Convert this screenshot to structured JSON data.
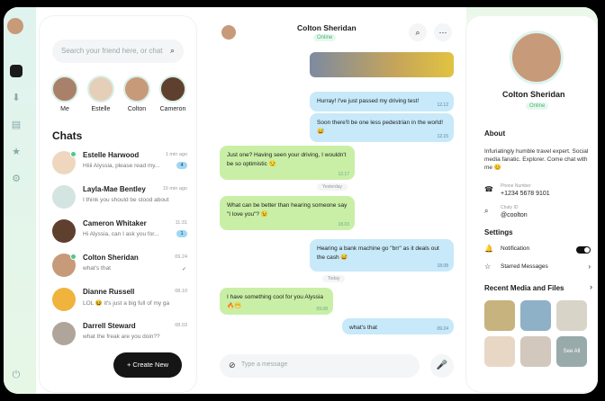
{
  "search": {
    "placeholder": "Search your friend here, or chat"
  },
  "stories": [
    {
      "name": "Me"
    },
    {
      "name": "Estelle"
    },
    {
      "name": "Colton"
    },
    {
      "name": "Cameron"
    }
  ],
  "chats_title": "Chats",
  "chats": [
    {
      "name": "Estelle Harwood",
      "preview": "Hiiii Alyssia, please read my...",
      "time": "1 min ago",
      "badge": "4",
      "online": true
    },
    {
      "name": "Layla-Mae Bentley",
      "preview": "I think you should be stood about ...",
      "time": "15 min ago"
    },
    {
      "name": "Cameron Whitaker",
      "preview": "Hi Alyssia, can I ask you for...",
      "time": "11:31",
      "badge": "1"
    },
    {
      "name": "Colton Sheridan",
      "preview": "what's that",
      "time": "09.24",
      "online": true
    },
    {
      "name": "Dianne Russell",
      "preview": "LOL 😆 it's just a big full of my ga...",
      "time": "08.10"
    },
    {
      "name": "Darrell Steward",
      "preview": "what the freak are you doin??",
      "time": "08.03"
    }
  ],
  "create_label": "+ Create New",
  "conversation": {
    "name": "Colton Sheridan",
    "status": "Online",
    "messages": [
      {
        "text": "Hurray! I've just passed my driving test!",
        "time": "12.12",
        "dir": "out"
      },
      {
        "text": "Soon there'll be one less pedestrian in the world! 😅",
        "time": "12.15",
        "dir": "out"
      },
      {
        "text": "Just one? Having seen your driving, I wouldn't be so optimistic 😏",
        "time": "12.17",
        "dir": "in"
      },
      {
        "text": "What can be better than hearing someone say \"I love you\"? 😉",
        "time": "18.03",
        "dir": "in"
      },
      {
        "text": "Hearing a bank machine go \"brr\" as it deals out the cash 😅",
        "time": "18.08",
        "dir": "out"
      },
      {
        "text": "I have something cool for you Alyssia 🔥😁",
        "time": "09.08",
        "dir": "in"
      },
      {
        "text": "what's that",
        "time": "09.24",
        "dir": "out"
      }
    ],
    "date_yesterday": "Yesterday",
    "date_today": "Today",
    "composer_placeholder": "Type a message"
  },
  "profile": {
    "name": "Colton Sheridan",
    "status": "Online",
    "about_title": "About",
    "bio": "Infuriatingly humble travel expert. Social media fanatic. Explorer. Come chat with me 😊",
    "phone_label": "Phone Number",
    "phone": "+1234 5678 9101",
    "chatid_label": "Chaty ID",
    "chatid": "@coolton",
    "settings_title": "Settings",
    "notification": "Notification",
    "starred": "Starred Messages",
    "media_title": "Recent Media and Files",
    "see_all": "See All"
  }
}
